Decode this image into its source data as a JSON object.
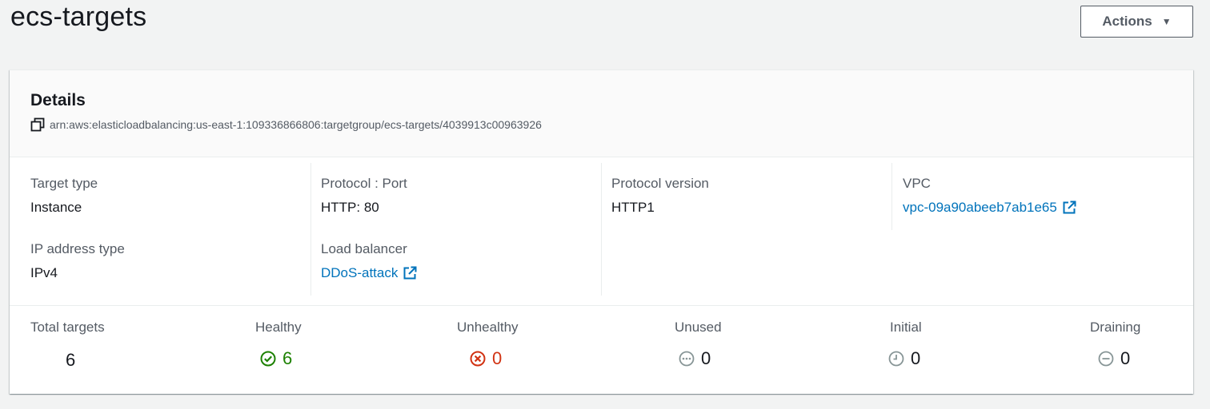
{
  "header": {
    "title": "ecs-targets",
    "actions_label": "Actions"
  },
  "details": {
    "title": "Details",
    "arn": "arn:aws:elasticloadbalancing:us-east-1:109336866806:targetgroup/ecs-targets/4039913c00963926",
    "fields": {
      "target_type": {
        "label": "Target type",
        "value": "Instance"
      },
      "ip_address_type": {
        "label": "IP address type",
        "value": "IPv4"
      },
      "protocol_port": {
        "label": "Protocol : Port",
        "value": "HTTP: 80"
      },
      "load_balancer": {
        "label": "Load balancer",
        "value": "DDoS-attack"
      },
      "protocol_version": {
        "label": "Protocol version",
        "value": "HTTP1"
      },
      "vpc": {
        "label": "VPC",
        "value": "vpc-09a90abeeb7ab1e65"
      }
    }
  },
  "stats": {
    "total": {
      "label": "Total targets",
      "value": "6"
    },
    "healthy": {
      "label": "Healthy",
      "value": "6",
      "icon": "check-circle-icon",
      "color": "#1d8102"
    },
    "unhealthy": {
      "label": "Unhealthy",
      "value": "0",
      "icon": "x-circle-icon",
      "color": "#d13212"
    },
    "unused": {
      "label": "Unused",
      "value": "0",
      "icon": "ellipsis-circle-icon",
      "color": "#16191f"
    },
    "initial": {
      "label": "Initial",
      "value": "0",
      "icon": "clock-icon",
      "color": "#16191f"
    },
    "draining": {
      "label": "Draining",
      "value": "0",
      "icon": "minus-circle-icon",
      "color": "#16191f"
    }
  },
  "colors": {
    "link": "#0073bb",
    "label": "#545b64",
    "text": "#16191f",
    "icon_gray": "#879596"
  }
}
